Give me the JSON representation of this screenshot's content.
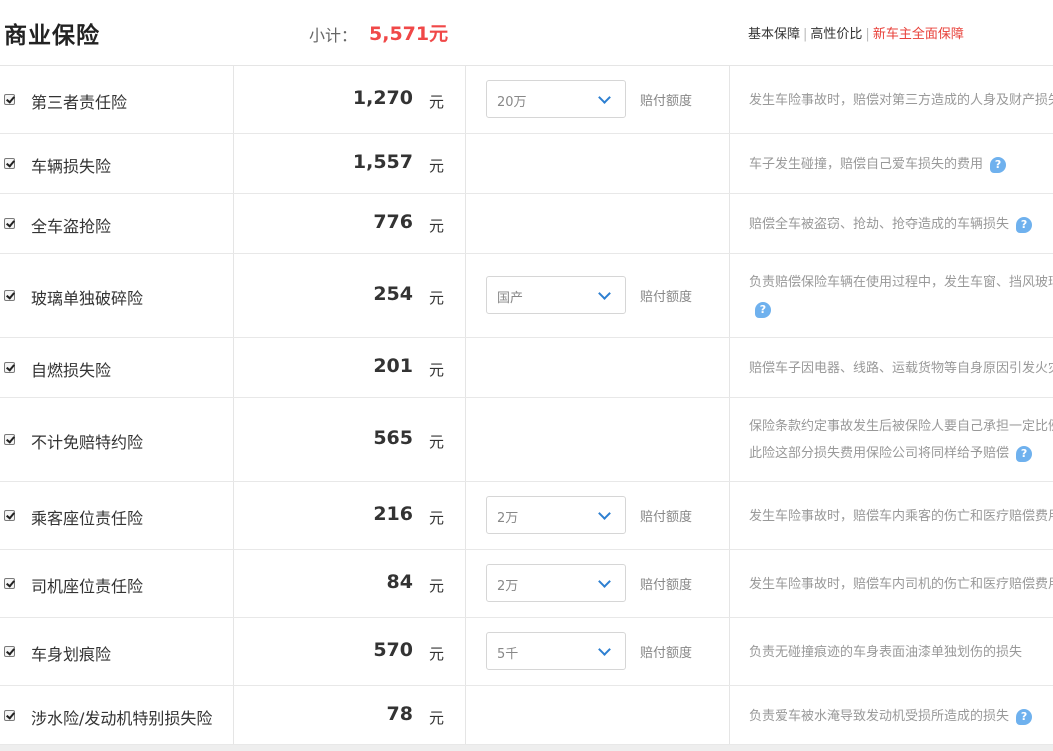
{
  "header": {
    "title": "商业保险",
    "subtotal_label": "小计：",
    "subtotal_value": "5,571元",
    "filters": [
      {
        "label": "基本保障",
        "active": false
      },
      {
        "label": "高性价比",
        "active": false
      },
      {
        "label": "新车主全面保障",
        "active": true
      }
    ]
  },
  "colors": {
    "accent": "#e8413a",
    "price_total": "#f04848",
    "help_icon": "#6fb1ee",
    "chevron": "#2d7fd1"
  },
  "unit_label": "元",
  "select_label": "赔付额度",
  "rows": [
    {
      "name": "第三者责任险",
      "checked": true,
      "price": "1,270",
      "select": "20万",
      "desc": [
        "发生车险事故时，赔偿对第三方造成的人身及财产损失"
      ],
      "help": false
    },
    {
      "name": "车辆损失险",
      "checked": true,
      "price": "1,557",
      "select": null,
      "desc": [
        "车子发生碰撞，赔偿自己爱车损失的费用"
      ],
      "help": true
    },
    {
      "name": "全车盗抢险",
      "checked": true,
      "price": "776",
      "select": null,
      "desc": [
        "赔偿全车被盗窃、抢劫、抢夺造成的车辆损失"
      ],
      "help": true
    },
    {
      "name": "玻璃单独破碎险",
      "checked": true,
      "price": "254",
      "select": "国产",
      "desc": [
        "负责赔偿保险车辆在使用过程中，发生车窗、挡风玻璃"
      ],
      "help": true,
      "help_newline": true
    },
    {
      "name": "自燃损失险",
      "checked": true,
      "price": "201",
      "select": null,
      "desc": [
        "赔偿车子因电器、线路、运载货物等自身原因引发火灾"
      ],
      "help": false
    },
    {
      "name": "不计免赔特约险",
      "checked": true,
      "price": "565",
      "select": null,
      "desc": [
        "保险条款约定事故发生后被保险人要自己承担一定比例",
        "此险这部分损失费用保险公司将同样给予赔偿"
      ],
      "help": true
    },
    {
      "name": "乘客座位责任险",
      "checked": true,
      "price": "216",
      "select": "2万",
      "desc": [
        "发生车险事故时，赔偿车内乘客的伤亡和医疗赔偿费用"
      ],
      "help": false
    },
    {
      "name": "司机座位责任险",
      "checked": true,
      "price": "84",
      "select": "2万",
      "desc": [
        "发生车险事故时，赔偿车内司机的伤亡和医疗赔偿费用"
      ],
      "help": false
    },
    {
      "name": "车身划痕险",
      "checked": true,
      "price": "570",
      "select": "5千",
      "desc": [
        "负责无碰撞痕迹的车身表面油漆单独划伤的损失"
      ],
      "help": false
    },
    {
      "name": "涉水险/发动机特别损失险",
      "checked": true,
      "price": "78",
      "select": null,
      "desc": [
        "负责爱车被水淹导致发动机受损所造成的损失"
      ],
      "help": true
    }
  ]
}
